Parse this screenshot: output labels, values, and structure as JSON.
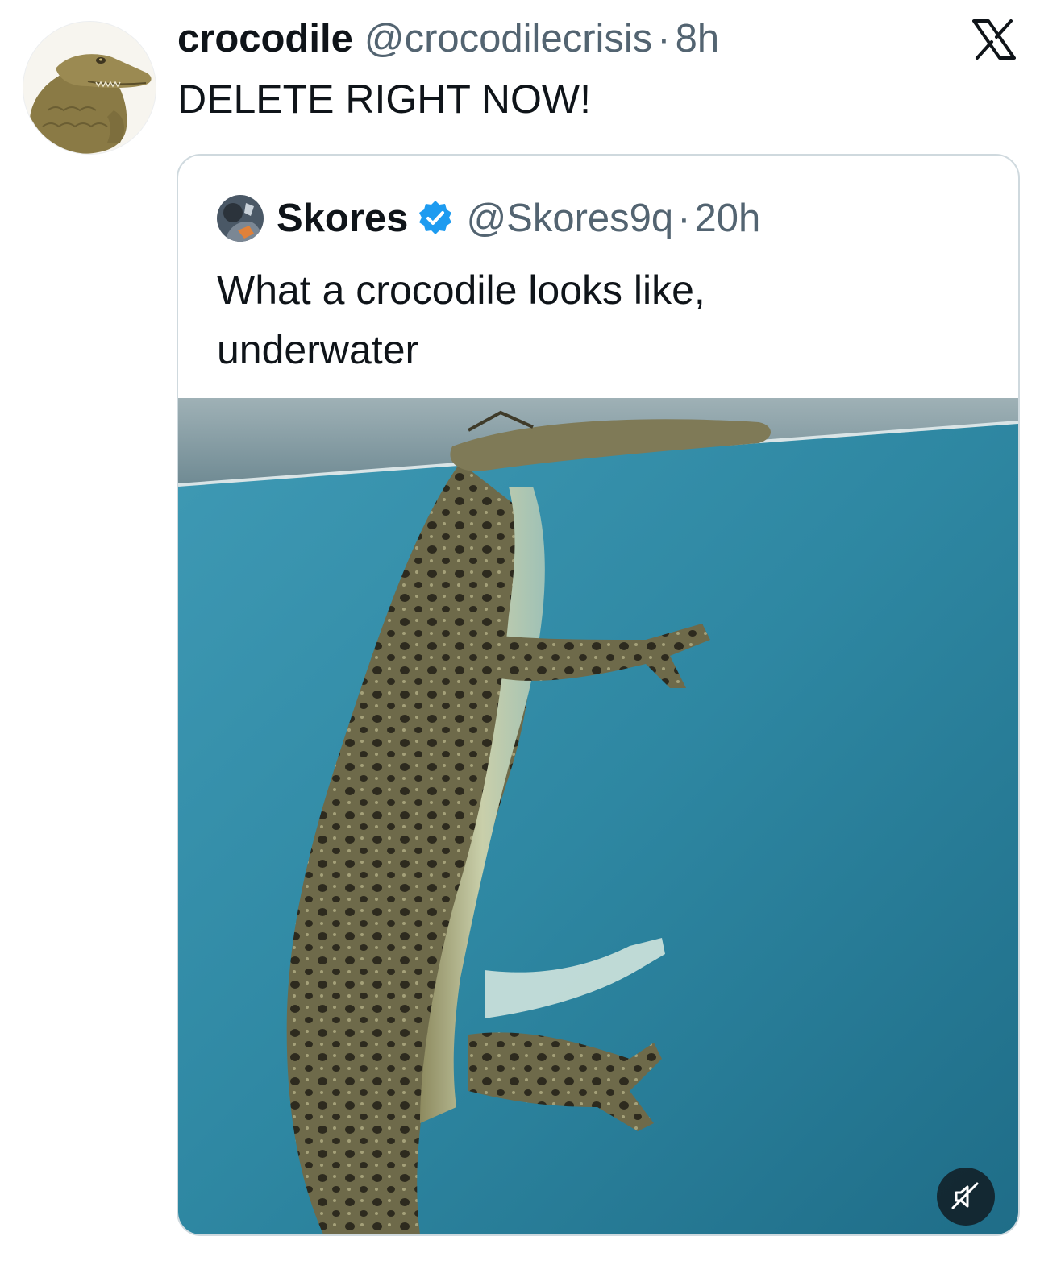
{
  "tweet": {
    "author_name": "crocodile",
    "author_handle": "@crocodilecrisis",
    "separator": "·",
    "time": "8h",
    "text": "DELETE RIGHT NOW!"
  },
  "quoted_tweet": {
    "author_name": "Skores",
    "author_handle": "@Skores9q",
    "separator": "·",
    "time": "20h",
    "verified": true,
    "text": "What a crocodile looks like, underwater",
    "media": {
      "type": "video",
      "muted": true
    }
  },
  "icons": {
    "platform_logo": "x-logo-icon",
    "verified_badge": "verified-badge-icon",
    "mute": "muted-speaker-icon"
  },
  "colors": {
    "text_primary": "#0f1419",
    "text_secondary": "#536471",
    "verified_blue": "#1d9bf0",
    "border": "#cfd9de",
    "water": "#2f8aa4"
  }
}
